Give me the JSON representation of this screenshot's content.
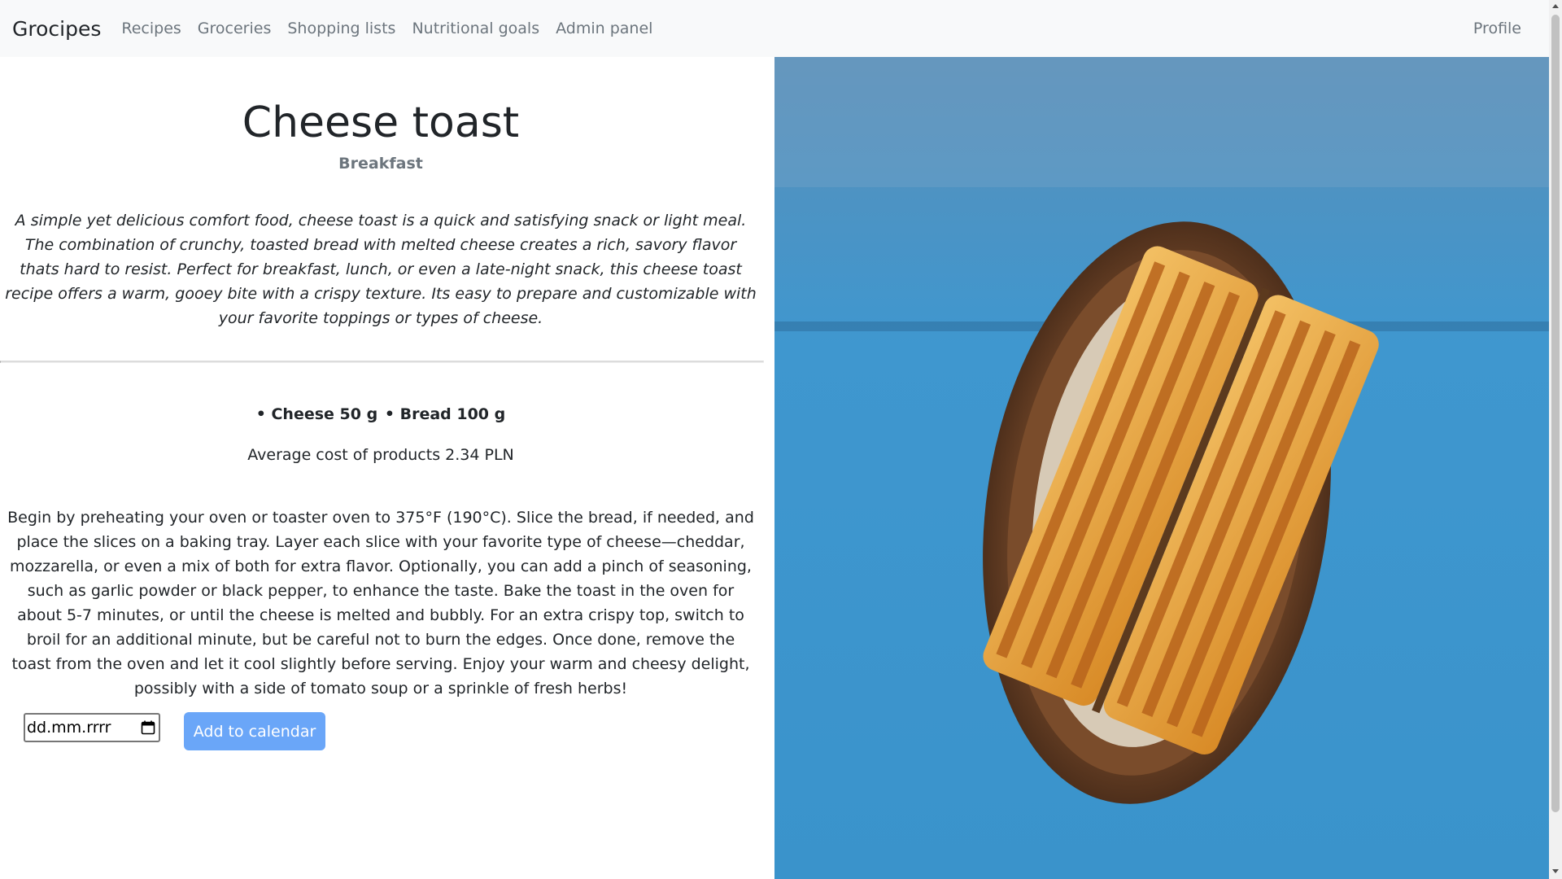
{
  "nav": {
    "brand": "Grocipes",
    "links": [
      "Recipes",
      "Groceries",
      "Shopping lists",
      "Nutritional goals",
      "Admin panel"
    ],
    "profile": "Profile"
  },
  "recipe": {
    "title": "Cheese toast",
    "category": "Breakfast",
    "description": "A simple yet delicious comfort food, cheese toast is a quick and satisfying snack or light meal. The combination of crunchy, toasted bread with melted cheese creates a rich, savory flavor thats hard to resist. Perfect for breakfast, lunch, or even a late-night snack, this cheese toast recipe offers a warm, gooey bite with a crispy texture. Its easy to prepare and customizable with your favorite toppings or types of cheese.",
    "ingredients": [
      "• Cheese 50 g",
      "• Bread 100 g"
    ],
    "avg_cost": "Average cost of products 2.34 PLN",
    "instructions": "Begin by preheating your oven or toaster oven to 375°F (190°C). Slice the bread, if needed, and place the slices on a baking tray. Layer each slice with your favorite type of cheese—cheddar, mozzarella, or even a mix of both for extra flavor. Optionally, you can add a pinch of seasoning, such as garlic powder or black pepper, to enhance the taste. Bake the toast in the oven for about 5-7 minutes, or until the cheese is melted and bubbly. For an extra crispy top, switch to broil for an additional minute, but be careful not to burn the edges. Once done, remove the toast from the oven and let it cool slightly before serving. Enjoy your warm and cheesy delight, possibly with a side of tomato soup or a sprinkle of fresh herbs!"
  },
  "calendar": {
    "date_placeholder": "dd.mm.rrrr",
    "date_icon": "calendar-icon",
    "button_label": "Add to calendar"
  },
  "image": {
    "subject": "cheese-toast-photo",
    "colors": {
      "background": "#3d95cc",
      "plate": "#6b4226",
      "toast": "#e2a03a"
    }
  },
  "colors": {
    "navbar_bg": "#f8f9fa",
    "nav_link": "#6c757d",
    "button": "#6aa6f8"
  }
}
